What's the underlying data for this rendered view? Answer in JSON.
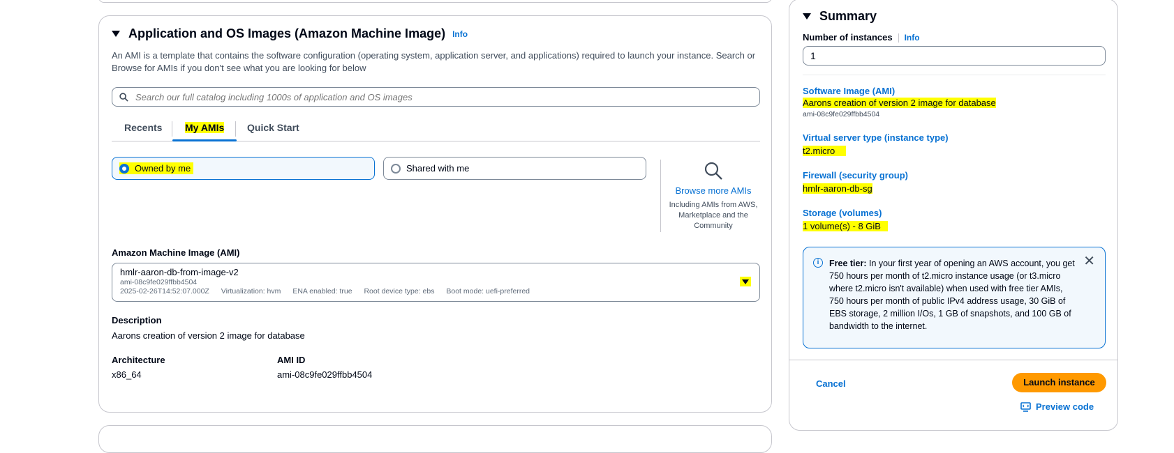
{
  "ami_section": {
    "title": "Application and OS Images (Amazon Machine Image)",
    "info": "Info",
    "description": "An AMI is a template that contains the software configuration (operating system, application server, and applications) required to launch your instance. Search or Browse for AMIs if you don't see what you are looking for below",
    "search_placeholder": "Search our full catalog including 1000s of application and OS images",
    "tabs": [
      "Recents",
      "My AMIs",
      "Quick Start"
    ],
    "active_tab": "My AMIs",
    "owned_by_me": "Owned by me",
    "shared_with_me": "Shared with me",
    "browse_more": "Browse more AMIs",
    "browse_sub": "Including AMIs from AWS, Marketplace and the Community",
    "ami_label": "Amazon Machine Image (AMI)",
    "selected_ami": {
      "name": "hmlr-aaron-db-from-image-v2",
      "id": "ami-08c9fe029ffbb4504",
      "date": "2025-02-26T14:52:07.000Z",
      "virtualization": "Virtualization: hvm",
      "ena": "ENA enabled: true",
      "root_device": "Root device type: ebs",
      "boot_mode": "Boot mode: uefi-preferred"
    },
    "description_label": "Description",
    "description_value": "Aarons creation of version 2 image for database",
    "architecture_label": "Architecture",
    "architecture_value": "x86_64",
    "ami_id_label": "AMI ID",
    "ami_id_value": "ami-08c9fe029ffbb4504"
  },
  "summary": {
    "title": "Summary",
    "instances_label": "Number of instances",
    "info": "Info",
    "instances_value": "1",
    "software_image_label": "Software Image (AMI)",
    "software_image_value": "Aarons creation of version 2 image for database",
    "software_image_id": "ami-08c9fe029ffbb4504",
    "instance_type_label": "Virtual server type (instance type)",
    "instance_type_value": "t2.micro",
    "firewall_label": "Firewall (security group)",
    "firewall_value": "hmlr-aaron-db-sg",
    "storage_label": "Storage (volumes)",
    "storage_value": "1 volume(s) - 8 GiB",
    "free_tier_heading": "Free tier:",
    "free_tier_text": "In your first year of opening an AWS account, you get 750 hours per month of t2.micro instance usage (or t3.micro where t2.micro isn't available) when used with free tier AMIs, 750 hours per month of public IPv4 address usage, 30 GiB of EBS storage, 2 million I/Os, 1 GB of snapshots, and 100 GB of bandwidth to the internet.",
    "cancel": "Cancel",
    "launch": "Launch instance",
    "preview_code": "Preview code"
  },
  "colors": {
    "highlight": "#ffff00",
    "link": "#0972d3",
    "primary_button": "#ff9900"
  }
}
